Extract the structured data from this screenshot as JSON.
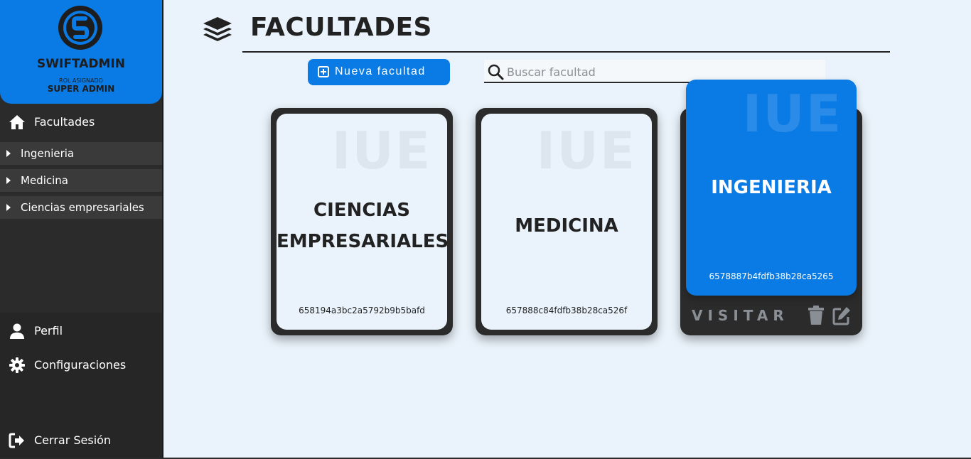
{
  "brand": {
    "name": "SWIFTADMIN",
    "role_label": "ROL ASIGNADO",
    "role_value": "SUPER ADMIN",
    "color": "#0a7ae4"
  },
  "sidebar": {
    "main": {
      "label": "Facultades",
      "icon": "home-icon"
    },
    "items": [
      {
        "label": "Ingenieria"
      },
      {
        "label": "Medicina"
      },
      {
        "label": "Ciencias empresariales"
      }
    ],
    "profile": {
      "label": "Perfil",
      "icon": "user-icon"
    },
    "settings": {
      "label": "Configuraciones",
      "icon": "gear-icon"
    },
    "logout": {
      "label": "Cerrar Sesión",
      "icon": "sign-out-icon"
    }
  },
  "header": {
    "title": "FACULTADES",
    "icon": "layers-icon"
  },
  "toolbar": {
    "new_label": "Nueva facultad",
    "search_placeholder": "Buscar facultad",
    "search_value": ""
  },
  "cards": [
    {
      "line1": "CIENCIAS",
      "line2": "EMPRESARIALES",
      "id": "658194a3bc2a5792b9b5bafd",
      "watermark": "IUE"
    },
    {
      "line1": "MEDICINA",
      "id": "657888c84fdfb38b28ca526f",
      "watermark": "IUE"
    },
    {
      "line1": "INGENIERIA",
      "id": "6578887b4fdfb38b28ca5265",
      "watermark": "IUE",
      "visit_label": "VISITAR"
    }
  ]
}
